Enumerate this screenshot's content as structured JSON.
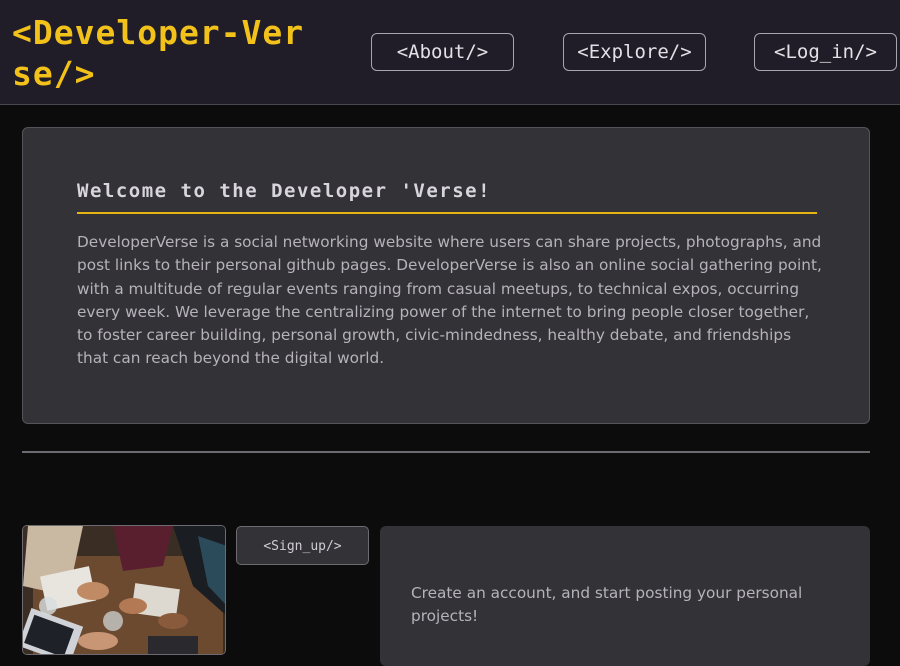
{
  "header": {
    "brand": "<Developer-Verse/>",
    "nav": {
      "about": "<About/>",
      "explore": "<Explore/>",
      "login": "<Log_in/>"
    }
  },
  "welcome": {
    "title": "Welcome to the Developer 'Verse!",
    "body": "DeveloperVerse is a social networking website where users can share projects, photographs, and post links to their personal github pages. DeveloperVerse is also an online social gathering point, with a multitude of regular events ranging from casual meetups, to technical expos, occurring every week. We leverage the centralizing power of the internet to bring people closer together, to foster career building, personal growth, civic-mindedness, healthy debate, and friendships that can reach beyond the digital world."
  },
  "signup": {
    "button_label": "<Sign_up/>",
    "description": "Create an account, and start posting your personal projects!"
  },
  "colors": {
    "accent": "#f2c21b",
    "header_bg": "#201c28",
    "card_bg": "#333236",
    "page_bg": "#0c0c0d"
  }
}
